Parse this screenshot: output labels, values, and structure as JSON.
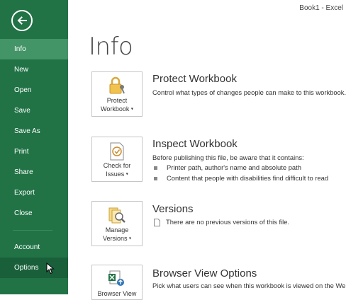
{
  "window": {
    "title": "Book1 - Excel"
  },
  "sidebar": {
    "items": [
      {
        "label": "Info"
      },
      {
        "label": "New"
      },
      {
        "label": "Open"
      },
      {
        "label": "Save"
      },
      {
        "label": "Save As"
      },
      {
        "label": "Print"
      },
      {
        "label": "Share"
      },
      {
        "label": "Export"
      },
      {
        "label": "Close"
      },
      {
        "label": "Account"
      },
      {
        "label": "Options"
      }
    ],
    "selected": "Info",
    "hovered": "Options"
  },
  "main": {
    "title": "Info",
    "sections": [
      {
        "tile_lines": [
          "Protect",
          "Workbook"
        ],
        "title": "Protect Workbook",
        "description": "Control what types of changes people can make to this workbook."
      },
      {
        "tile_lines": [
          "Check for",
          "Issues"
        ],
        "title": "Inspect Workbook",
        "description": "Before publishing this file, be aware that it contains:",
        "bullets": [
          "Printer path, author's name and absolute path",
          "Content that people with disabilities find difficult to read"
        ]
      },
      {
        "tile_lines": [
          "Manage",
          "Versions"
        ],
        "title": "Versions",
        "description": "There are no previous versions of this file."
      },
      {
        "tile_lines": [
          "Browser View",
          ""
        ],
        "title": "Browser View Options",
        "description": "Pick what users can see when this workbook is viewed on the Web."
      }
    ]
  },
  "colors": {
    "brand_green": "#217346",
    "selected_green": "#439467"
  },
  "icons": [
    "back-arrow-icon",
    "lock-key-icon",
    "inspect-document-icon",
    "versions-search-icon",
    "excel-globe-icon",
    "mouse-cursor-icon"
  ]
}
